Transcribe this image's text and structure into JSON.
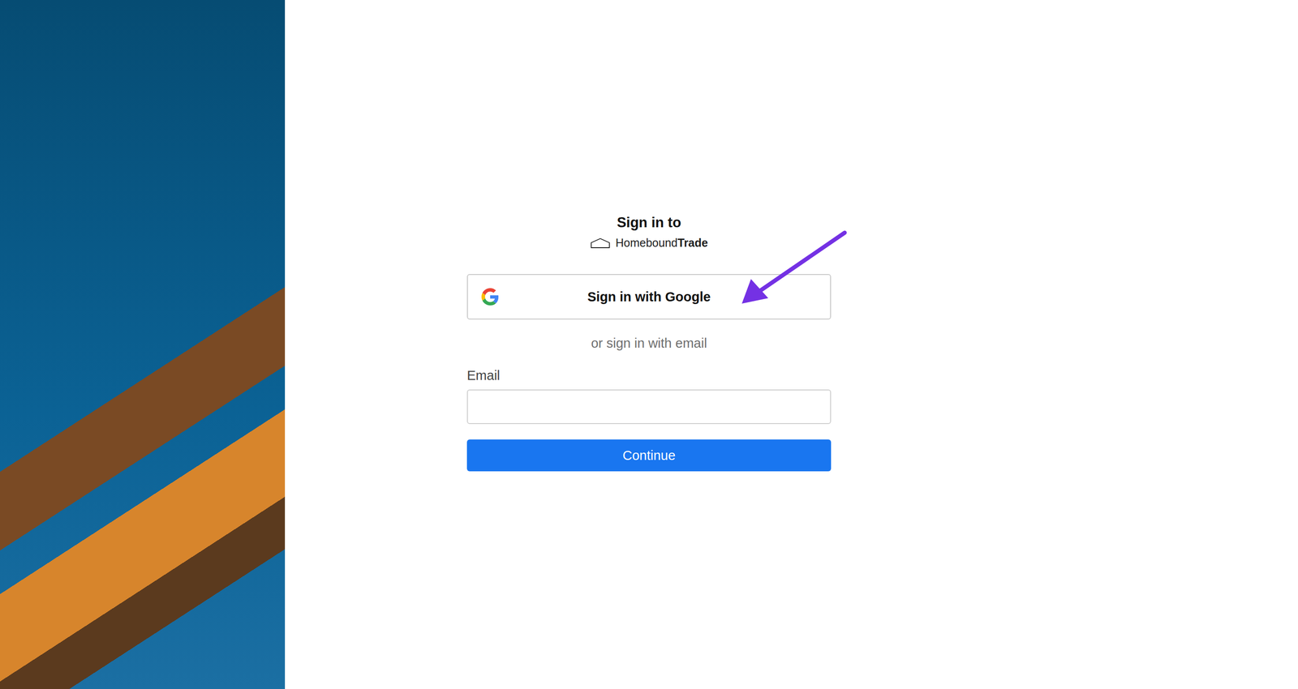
{
  "heading": "Sign in to",
  "brand": {
    "name": "Homebound",
    "suffix": "Trade"
  },
  "google_button": {
    "label": "Sign in with Google"
  },
  "divider": "or sign in with email",
  "email_field": {
    "label": "Email",
    "value": ""
  },
  "continue_button": {
    "label": "Continue"
  }
}
